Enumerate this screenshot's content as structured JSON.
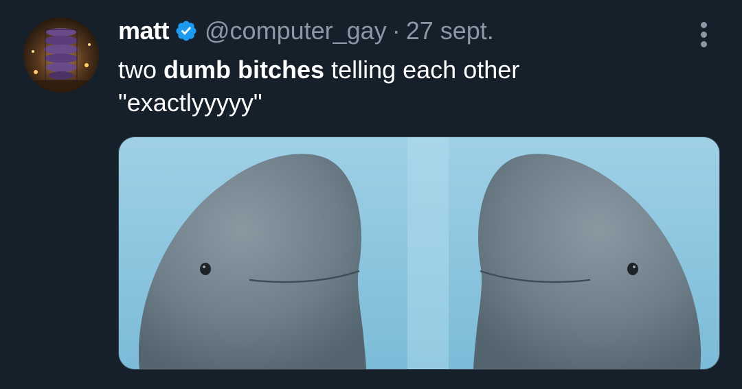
{
  "tweet": {
    "display_name": "matt",
    "handle": "@computer_gay",
    "separator": "·",
    "date": "27 sept.",
    "text_part1": "two ",
    "text_bold": "dumb bitches",
    "text_part2": " telling each other",
    "text_line2": "\"exactlyyyyy\""
  },
  "icons": {
    "verified": "verified-badge-icon",
    "more": "more-options-icon"
  },
  "colors": {
    "background": "#15202b",
    "verified_blue": "#1d9bf0",
    "secondary_text": "#8b98a5",
    "primary_text": "#ffffff"
  }
}
